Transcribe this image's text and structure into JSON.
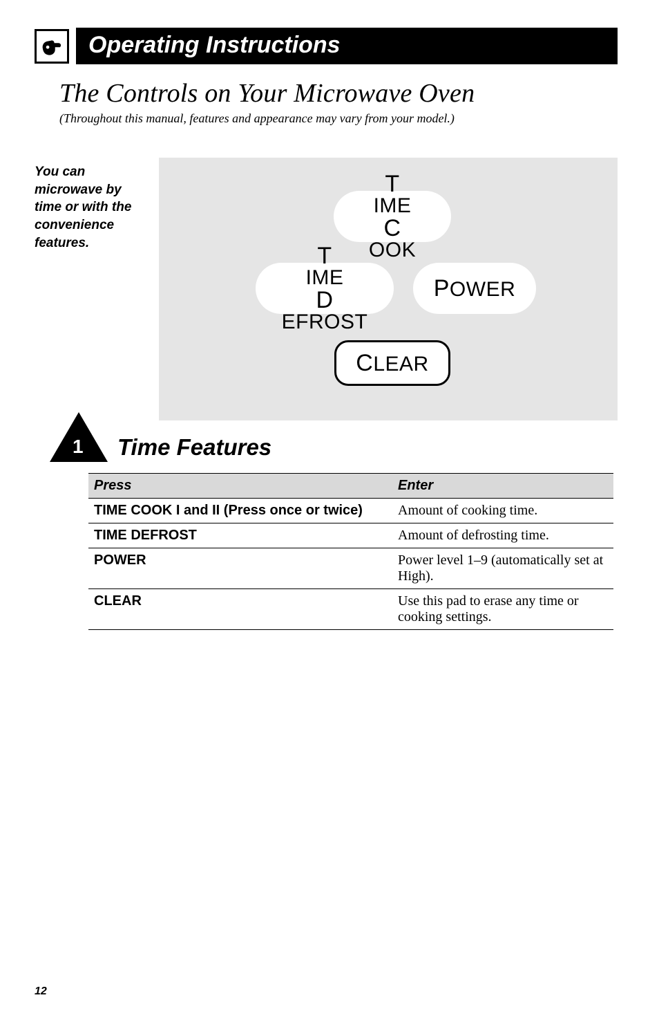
{
  "header": {
    "bar_title": "Operating Instructions"
  },
  "section": {
    "title": "The Controls on Your Microwave Oven",
    "subtitle": "(Throughout this manual, features and appearance may vary from your model.)"
  },
  "side_note": "You can microwave by time or with the convenience features.",
  "panel": {
    "time_cook_l1": "TIME",
    "time_cook_l2": "COOK",
    "time_defrost_l1": "TIME",
    "time_defrost_l2": "DEFROST",
    "power": "POWER",
    "clear": "CLEAR"
  },
  "triangle": {
    "number": "1",
    "title": "Time Features"
  },
  "table": {
    "head_press": "Press",
    "head_enter": "Enter",
    "rows": [
      {
        "press": "TIME COOK I and II (Press once or twice)",
        "enter": "Amount of cooking time."
      },
      {
        "press": "TIME DEFROST",
        "enter": "Amount of defrosting time."
      },
      {
        "press": "POWER",
        "enter": "Power level 1–9 (automatically set at High)."
      },
      {
        "press": "CLEAR",
        "enter": "Use this pad to erase any time or cooking settings."
      }
    ]
  },
  "page_number": "12"
}
